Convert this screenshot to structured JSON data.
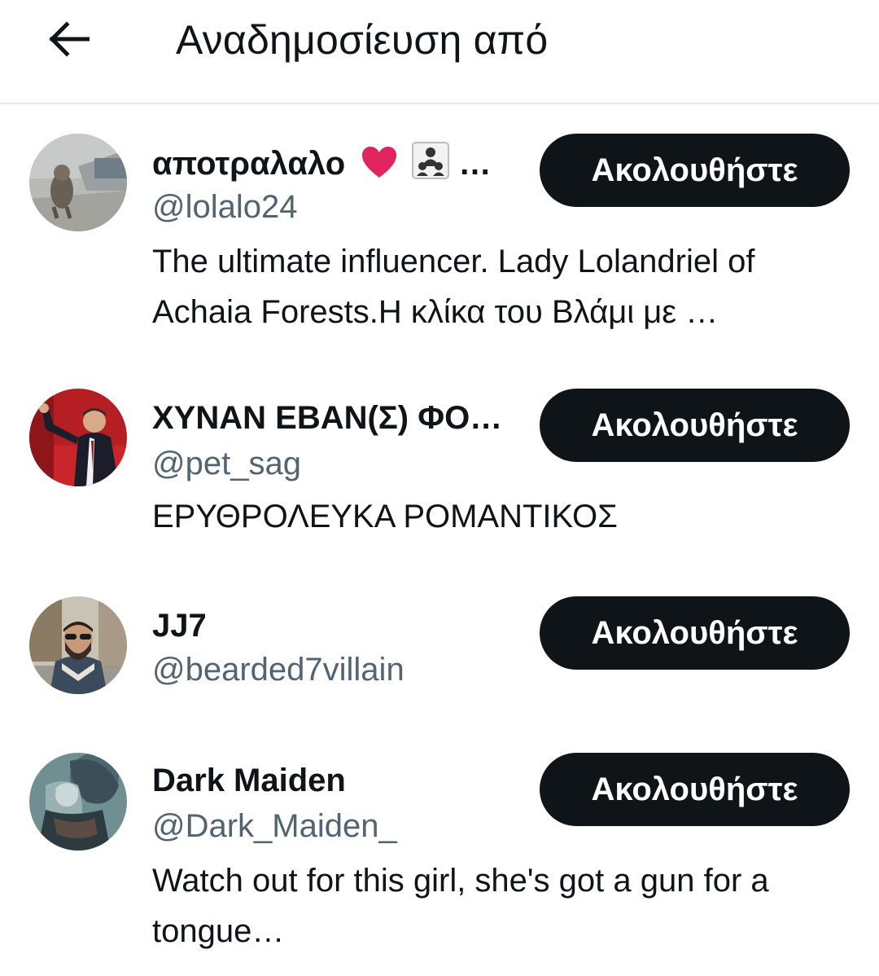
{
  "header": {
    "title": "Αναδημοσίευση από",
    "back_icon": "arrow-left-icon"
  },
  "users": [
    {
      "name": "αποτραλαλο",
      "name_suffix": "…",
      "name_emoji": [
        "heart-emoji",
        "people-emoji"
      ],
      "handle": "@lolalo24",
      "bio": "The ultimate influencer. Lady Lolandriel of Achaia Forests.Η κλίκα του Βλάμι με …",
      "follow_label": "Ακολουθήστε"
    },
    {
      "name": "ΧΥΝΑΝ ΕΒΑΝ(Σ) ΦΟ…",
      "handle": "@pet_sag",
      "bio": "ΕΡΥΘΡΟΛΕΥΚΑ ΡΟΜΑΝΤΙΚΟΣ",
      "follow_label": "Ακολουθήστε"
    },
    {
      "name": "JJ7",
      "handle": "@bearded7villain",
      "bio": "",
      "follow_label": "Ακολουθήστε"
    },
    {
      "name": "Dark Maiden",
      "handle": "@Dark_Maiden_",
      "bio": "Watch out for this girl, she's got a gun for a tongue…",
      "follow_label": "Ακολουθήστε"
    }
  ],
  "colors": {
    "text_primary": "#0f1419",
    "text_secondary": "#536471",
    "button_bg": "#0f1419",
    "button_text": "#ffffff",
    "divider": "#e7e9ea",
    "heart": "#e0245e"
  }
}
